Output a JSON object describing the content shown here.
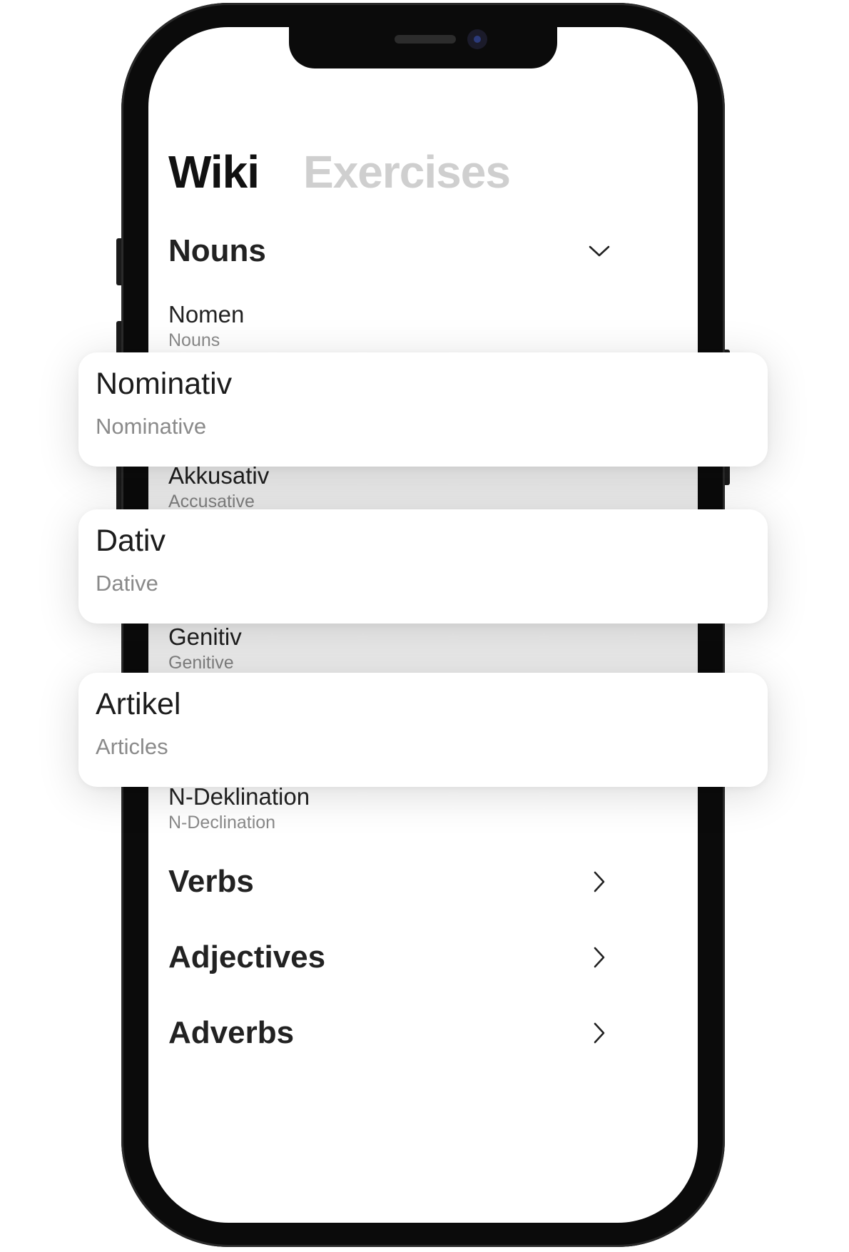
{
  "tabs": {
    "wiki": "Wiki",
    "exercises": "Exercises"
  },
  "sections": {
    "nouns": "Nouns",
    "verbs": "Verbs",
    "adjectives": "Adjectives",
    "adverbs": "Adverbs"
  },
  "nouns_items": [
    {
      "title": "Nomen",
      "subtitle": "Nouns"
    },
    {
      "title": "Akkusativ",
      "subtitle": "Accusative"
    },
    {
      "title": "Genitiv",
      "subtitle": "Genitive"
    },
    {
      "title": "N-Deklination",
      "subtitle": "N-Declination"
    }
  ],
  "cards": [
    {
      "title": "Nominativ",
      "subtitle": "Nominative"
    },
    {
      "title": "Dativ",
      "subtitle": "Dative"
    },
    {
      "title": "Artikel",
      "subtitle": "Articles"
    }
  ],
  "icons": {
    "nouns_toggle": "chevron-down-icon",
    "verbs_toggle": "chevron-right-icon",
    "adjectives_toggle": "chevron-right-icon",
    "adverbs_toggle": "chevron-right-icon"
  },
  "colors": {
    "active_tab": "#111111",
    "inactive_tab": "#cfcfcf",
    "subtitle": "#8a8a8a",
    "phone_frame": "#0b0b0b"
  }
}
